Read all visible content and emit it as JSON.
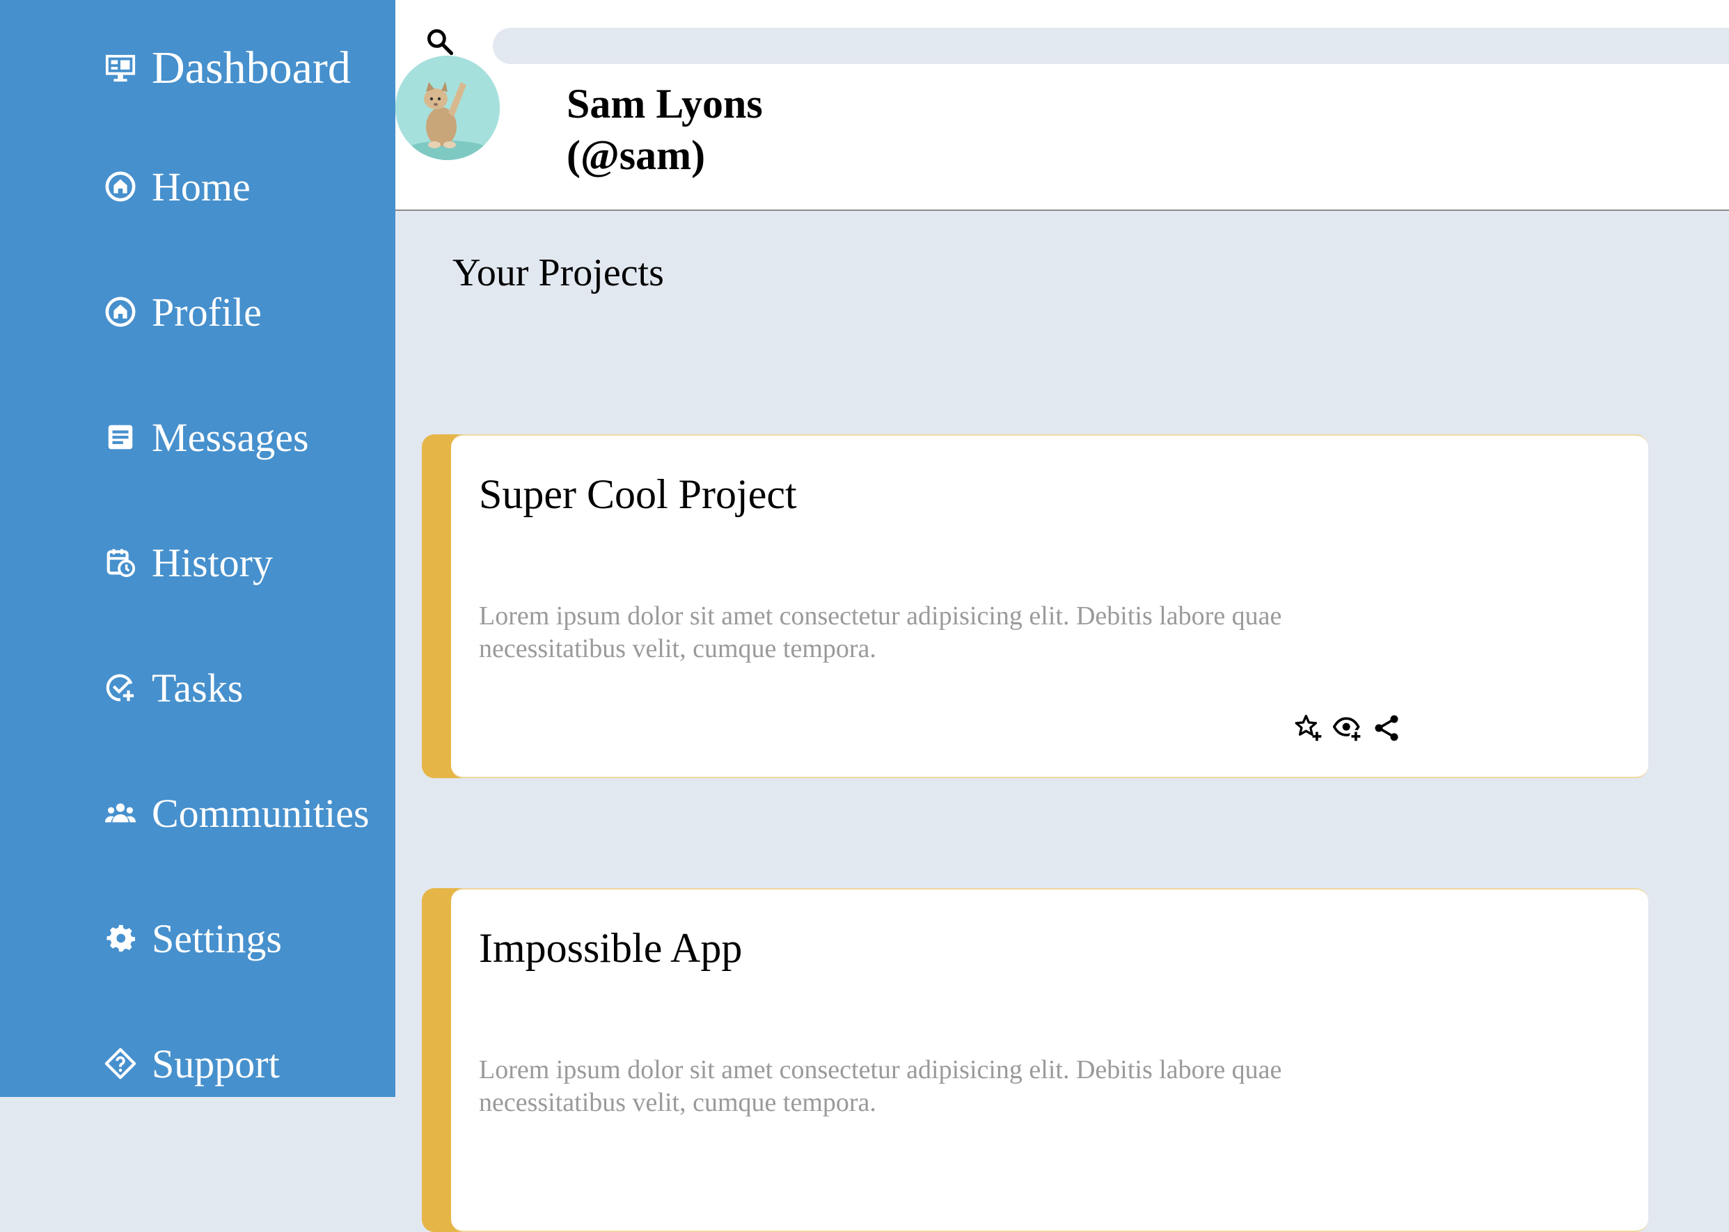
{
  "sidebar": {
    "brand": {
      "label": "Dashboard",
      "icon": "monitor-icon"
    },
    "items": [
      {
        "label": "Home",
        "icon": "home-icon"
      },
      {
        "label": "Profile",
        "icon": "home-icon"
      },
      {
        "label": "Messages",
        "icon": "inbox-icon"
      },
      {
        "label": "History",
        "icon": "calendar-clock-icon"
      },
      {
        "label": "Tasks",
        "icon": "check-add-icon"
      },
      {
        "label": "Communities",
        "icon": "people-icon"
      },
      {
        "label": "Settings",
        "icon": "gear-icon"
      },
      {
        "label": "Support",
        "icon": "diamond-help-icon"
      }
    ]
  },
  "header": {
    "search": {
      "value": "",
      "icon": "search-icon"
    },
    "user": {
      "name": "Sam Lyons",
      "handle": "(@sam)"
    }
  },
  "main": {
    "section_title": "Your Projects",
    "projects": [
      {
        "title": "Super Cool Project",
        "description": "Lorem ipsum dolor sit amet consectetur adipisicing elit. Debitis labore quae necessitatibus velit, cumque tempora."
      },
      {
        "title": "Impossible App",
        "description": "Lorem ipsum dolor sit amet consectetur adipisicing elit. Debitis labore quae necessitatibus velit, cumque tempora."
      }
    ]
  },
  "colors": {
    "sidebar_bg": "#4690cd",
    "page_bg": "#e2e8f0",
    "card_accent": "#e6b547",
    "description_text": "#9a9a9a"
  }
}
